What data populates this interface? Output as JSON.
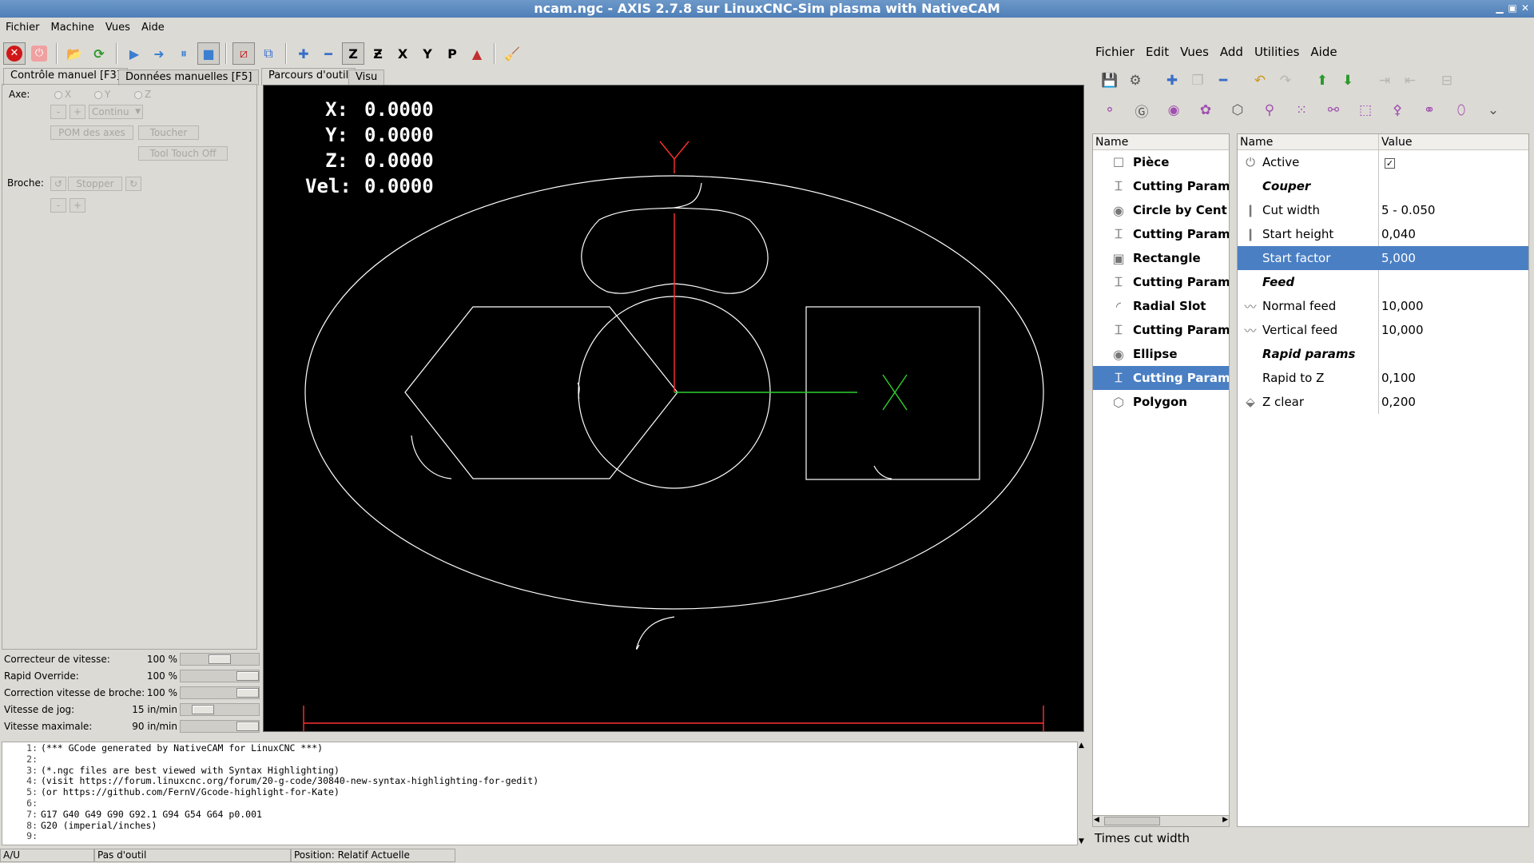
{
  "window": {
    "title": "ncam.ngc - AXIS 2.7.8 sur LinuxCNC-Sim plasma with NativeCAM"
  },
  "axis_menu": [
    "Fichier",
    "Machine",
    "Vues",
    "Aide"
  ],
  "tabs_left": [
    "Contrôle manuel [F3]",
    "Données manuelles [F5]"
  ],
  "tabs_view": [
    "Parcours d'outil",
    "Visu"
  ],
  "manual": {
    "axe_label": "Axe:",
    "axes": [
      "X",
      "Y",
      "Z"
    ],
    "minus": "-",
    "plus": "+",
    "jog_mode": "Continu",
    "home_button": "POM des axes",
    "touch_button": "Toucher",
    "tool_touch_button": "Tool Touch Off",
    "spindle_label": "Broche:",
    "spindle_stop": "Stopper"
  },
  "sliders": [
    {
      "label": "Correcteur de vitesse:",
      "value": "100 %",
      "pos": 0.5
    },
    {
      "label": "Rapid Override:",
      "value": "100 %",
      "pos": 1.0
    },
    {
      "label": "Correction vitesse de broche:",
      "value": "100 %",
      "pos": 1.0
    },
    {
      "label": "Vitesse de jog:",
      "value": "15 in/min",
      "pos": 0.2
    },
    {
      "label": "Vitesse maximale:",
      "value": "90 in/min",
      "pos": 1.0
    }
  ],
  "dro": [
    {
      "axis": "X:",
      "value": "0.0000"
    },
    {
      "axis": "Y:",
      "value": "0.0000"
    },
    {
      "axis": "Z:",
      "value": "0.0000"
    },
    {
      "axis": "Vel:",
      "value": "0.0000"
    }
  ],
  "gcode": [
    {
      "n": "1:",
      "text": "(*** GCode generated by NativeCAM for LinuxCNC ***)"
    },
    {
      "n": "2:",
      "text": ""
    },
    {
      "n": "3:",
      "text": "(*.ngc files are best viewed with Syntax Highlighting)"
    },
    {
      "n": "4:",
      "text": "(visit https://forum.linuxcnc.org/forum/20-g-code/30840-new-syntax-highlighting-for-gedit)"
    },
    {
      "n": "5:",
      "text": "(or https://github.com/FernV/Gcode-highlight-for-Kate)"
    },
    {
      "n": "6:",
      "text": ""
    },
    {
      "n": "7:",
      "text": "G17 G40 G49 G90 G92.1 G94 G54 G64 p0.001"
    },
    {
      "n": "8:",
      "text": "G20  (imperial/inches)"
    },
    {
      "n": "9:",
      "text": ""
    }
  ],
  "status": [
    "A/U",
    "Pas d'outil",
    "Position: Relatif Actuelle"
  ],
  "ncam_menu": [
    "Fichier",
    "Edit",
    "Vues",
    "Add",
    "Utilities",
    "Aide"
  ],
  "tree": {
    "header": "Name",
    "items": [
      {
        "label": "Pièce",
        "icon": "stock-icon",
        "glyph": "☐"
      },
      {
        "label": "Cutting Param",
        "icon": "cutting-params-icon",
        "glyph": "⌶"
      },
      {
        "label": "Circle by Cent",
        "icon": "circle-icon",
        "glyph": "◉"
      },
      {
        "label": "Cutting Param",
        "icon": "cutting-params-icon",
        "glyph": "⌶"
      },
      {
        "label": "Rectangle",
        "icon": "rectangle-icon",
        "glyph": "▣"
      },
      {
        "label": "Cutting Param",
        "icon": "cutting-params-icon",
        "glyph": "⌶"
      },
      {
        "label": "Radial Slot",
        "icon": "radial-slot-icon",
        "glyph": "◜"
      },
      {
        "label": "Cutting Param",
        "icon": "cutting-params-icon",
        "glyph": "⌶"
      },
      {
        "label": "Ellipse",
        "icon": "ellipse-icon",
        "glyph": "◉"
      },
      {
        "label": "Cutting Param",
        "icon": "cutting-params-icon",
        "glyph": "⌶",
        "selected": true
      },
      {
        "label": "Polygon",
        "icon": "polygon-icon",
        "glyph": "⬡"
      }
    ]
  },
  "props": {
    "header_name": "Name",
    "header_value": "Value",
    "rows": [
      {
        "name": "Active",
        "value": "✓",
        "icon": "power-icon",
        "glyph": "⏻",
        "checkbox": true
      },
      {
        "name": "Couper",
        "value": "",
        "group": true
      },
      {
        "name": "Cut width",
        "value": "5 - 0.050",
        "icon": "tool-icon",
        "glyph": "❙"
      },
      {
        "name": "Start height",
        "value": "0,040",
        "icon": "tool-icon",
        "glyph": "❙"
      },
      {
        "name": "Start factor",
        "value": "5,000",
        "icon": "blank-icon",
        "glyph": "",
        "selected": true
      },
      {
        "name": "Feed",
        "value": "",
        "group": true
      },
      {
        "name": "Normal feed",
        "value": "10,000",
        "icon": "feed-icon",
        "glyph": "〰"
      },
      {
        "name": "Vertical feed",
        "value": "10,000",
        "icon": "feed-icon",
        "glyph": "〰"
      },
      {
        "name": "Rapid params",
        "value": "",
        "group": true
      },
      {
        "name": "Rapid to Z",
        "value": "0,100",
        "icon": "blank-icon",
        "glyph": ""
      },
      {
        "name": "Z clear",
        "value": "0,200",
        "icon": "z-clear-icon",
        "glyph": "⬙"
      }
    ]
  },
  "hint": "Times cut width",
  "colors": {
    "selection": "#4a7fc4",
    "titlebar": "#4f7fb8",
    "path": "#ffffff",
    "axis_red": "#ff3030",
    "axis_green": "#30d030"
  }
}
